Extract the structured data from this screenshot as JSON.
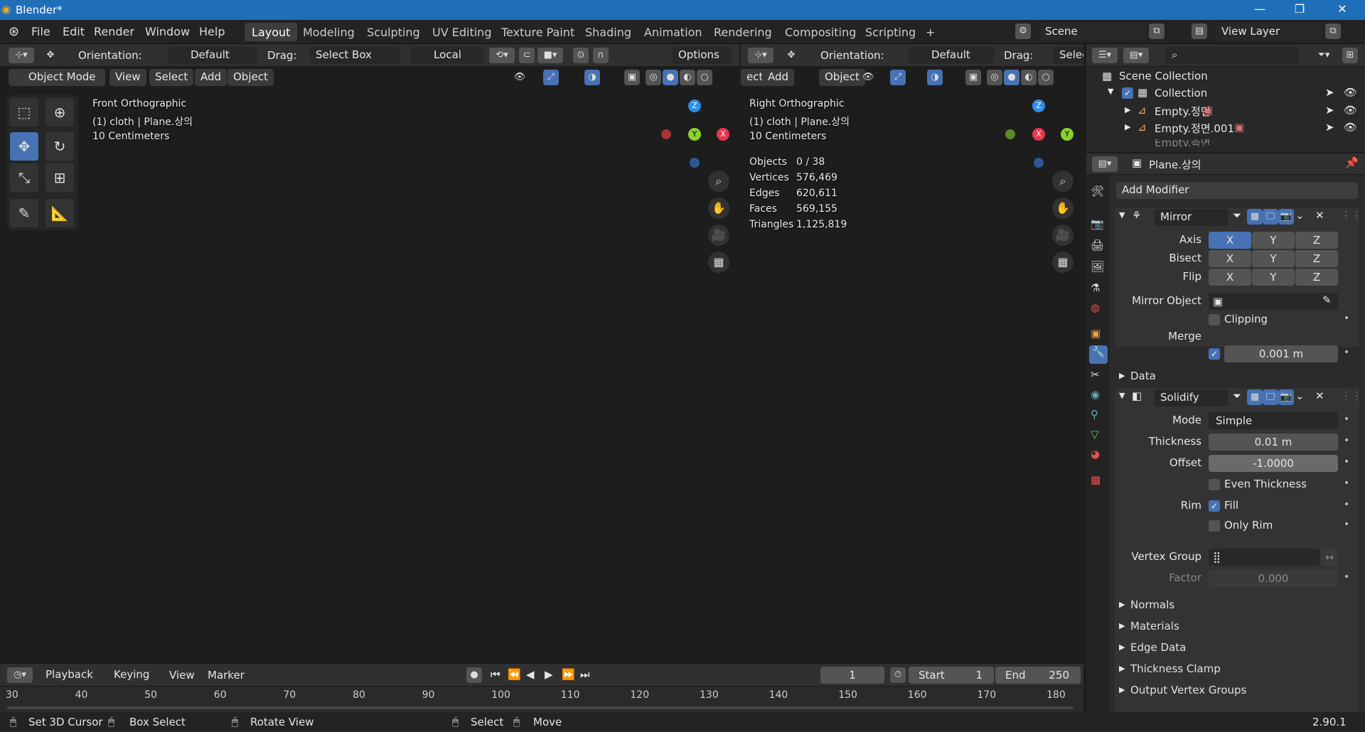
{
  "app": {
    "title": "Blender*",
    "version": "2.90.1"
  },
  "menu": [
    "File",
    "Edit",
    "Render",
    "Window",
    "Help"
  ],
  "workspaces": [
    "Layout",
    "Modeling",
    "Sculpting",
    "UV Editing",
    "Texture Paint",
    "Shading",
    "Animation",
    "Rendering",
    "Compositing",
    "Scripting",
    "+"
  ],
  "scene": {
    "scene": "Scene",
    "view_layer": "View Layer"
  },
  "viewport_header": {
    "orientation_label": "Orientation:",
    "orientation": "Default",
    "drag_label": "Drag:",
    "drag": "Select Box",
    "pivot": "Local",
    "options": "Options"
  },
  "viewport_header_right": {
    "orientation_label": "Orientation:",
    "orientation": "Default",
    "drag_label": "Drag:",
    "drag": "Selec"
  },
  "viewport_menu": {
    "mode": "Object Mode",
    "view": "View",
    "select": "Select",
    "add": "Add",
    "object": "Object"
  },
  "viewport_menu_right": {
    "select": "ect",
    "add": "Add",
    "object": "Object"
  },
  "left_view": {
    "name": "Front Orthographic",
    "context": "(1) cloth | Plane.상의",
    "scale": "10 Centimeters"
  },
  "right_view": {
    "name": "Right Orthographic",
    "context": "(1) cloth | Plane.상의",
    "scale": "10 Centimeters",
    "stats": [
      {
        "k": "Objects",
        "v": "0 / 38"
      },
      {
        "k": "Vertices",
        "v": "576,469"
      },
      {
        "k": "Edges",
        "v": "620,611"
      },
      {
        "k": "Faces",
        "v": "569,155"
      },
      {
        "k": "Triangles",
        "v": "1,125,819"
      }
    ]
  },
  "gizmo": {
    "z": "Z",
    "y": "Y",
    "x": "X"
  },
  "outliner": {
    "root": "Scene Collection",
    "collection": "Collection",
    "items": [
      "Empty.정면",
      "Empty.정면.001",
      "Empty.측면"
    ]
  },
  "properties": {
    "object": "Plane.상의",
    "add_modifier": "Add Modifier",
    "mirror": {
      "name": "Mirror",
      "axis_label": "Axis",
      "bisect_label": "Bisect",
      "flip_label": "Flip",
      "x": "X",
      "y": "Y",
      "z": "Z",
      "mirror_object_label": "Mirror Object",
      "clipping": "Clipping",
      "merge_label": "Merge",
      "merge_value": "0.001 m",
      "data": "Data"
    },
    "solidify": {
      "name": "Solidify",
      "mode_label": "Mode",
      "mode": "Simple",
      "thickness_label": "Thickness",
      "thickness": "0.01 m",
      "offset_label": "Offset",
      "offset": "-1.0000",
      "even_thickness": "Even Thickness",
      "rim_label": "Rim",
      "fill": "Fill",
      "only_rim": "Only Rim",
      "vertex_group_label": "Vertex Group",
      "factor_label": "Factor",
      "factor": "0.000"
    },
    "panels": [
      "Normals",
      "Materials",
      "Edge Data",
      "Thickness Clamp",
      "Output Vertex Groups"
    ]
  },
  "timeline": {
    "playback": "Playback",
    "keying": "Keying",
    "view": "View",
    "marker": "Marker",
    "frame": "1",
    "start_label": "Start",
    "start": "1",
    "end_label": "End",
    "end": "250",
    "ticks": [
      "30",
      "40",
      "50",
      "60",
      "70",
      "80",
      "90",
      "100",
      "110",
      "120",
      "130",
      "140",
      "150",
      "160",
      "170",
      "180"
    ]
  },
  "statusbar": {
    "a": "Set 3D Cursor",
    "b": "Box Select",
    "c": "Rotate View",
    "d": "Select",
    "e": "Move"
  },
  "colors": {
    "accent": "#4772b3",
    "titlebar": "#1f6fb8",
    "gizmo_x": "#e8364d",
    "gizmo_y": "#8bd12e",
    "gizmo_z": "#2e8de8"
  }
}
